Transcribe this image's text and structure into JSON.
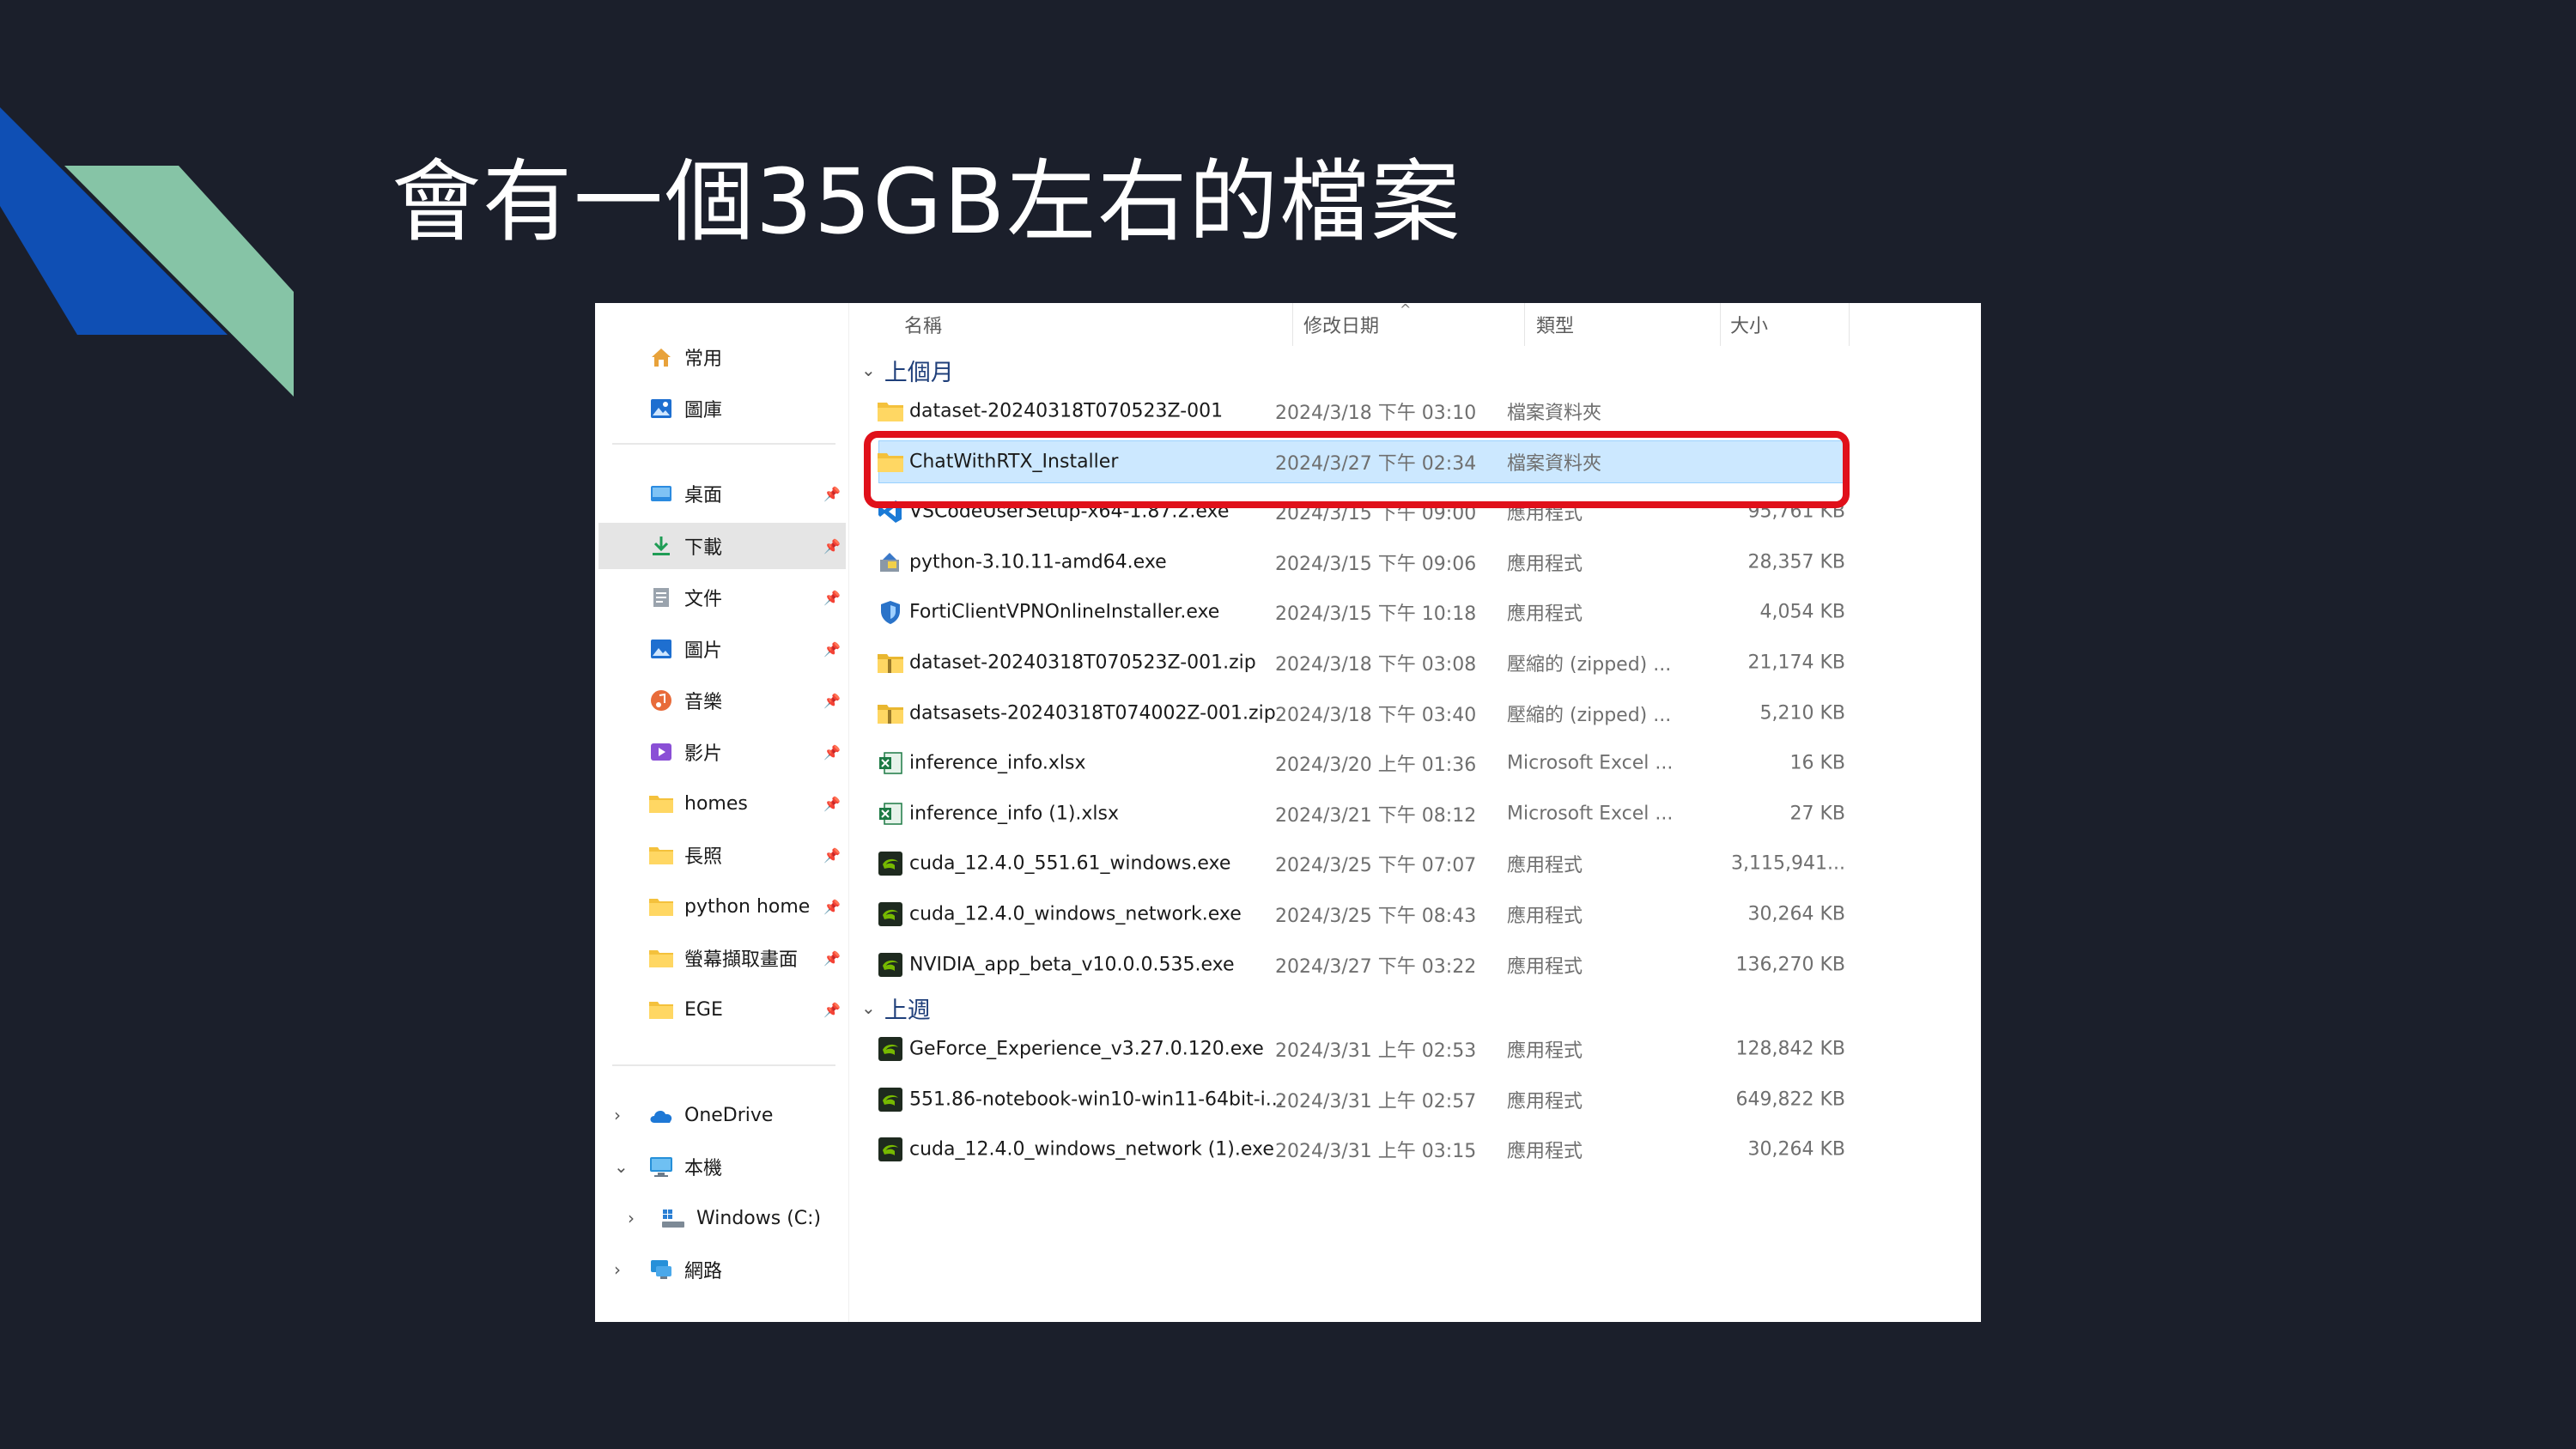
{
  "slide": {
    "title": "會有一個35GB左右的檔案",
    "accent_colors": {
      "blue": "#0f4fb4",
      "green": "#86c4a6",
      "background": "#1b1f2b",
      "highlight": "#e0101a"
    }
  },
  "explorer": {
    "nav": {
      "quick": [
        {
          "label": "常用",
          "icon": "home-icon"
        },
        {
          "label": "圖庫",
          "icon": "gallery-icon"
        }
      ],
      "pinned": [
        {
          "label": "桌面",
          "icon": "desktop-icon"
        },
        {
          "label": "下載",
          "icon": "download-icon",
          "selected": true
        },
        {
          "label": "文件",
          "icon": "document-icon"
        },
        {
          "label": "圖片",
          "icon": "pictures-icon"
        },
        {
          "label": "音樂",
          "icon": "music-icon"
        },
        {
          "label": "影片",
          "icon": "videos-icon"
        },
        {
          "label": "homes",
          "icon": "folder-icon"
        },
        {
          "label": "長照",
          "icon": "folder-icon"
        },
        {
          "label": "python home",
          "icon": "folder-icon"
        },
        {
          "label": "螢幕擷取畫面",
          "icon": "folder-icon"
        },
        {
          "label": "EGE",
          "icon": "folder-icon"
        }
      ],
      "tree": [
        {
          "label": "OneDrive",
          "icon": "cloud-icon",
          "chevron": "›"
        },
        {
          "label": "本機",
          "icon": "pc-icon",
          "chevron": "⌄"
        },
        {
          "label": "Windows (C:)",
          "icon": "drive-icon",
          "chevron": "›"
        },
        {
          "label": "網路",
          "icon": "network-icon",
          "chevron": "›"
        }
      ],
      "pin_glyph": "📌"
    },
    "columns": {
      "name": "名稱",
      "date": "修改日期",
      "type": "類型",
      "size": "大小"
    },
    "groups": [
      {
        "label": "上個月",
        "rows": [
          {
            "name": "dataset-20240318T070523Z-001",
            "date": "2024/3/18 下午 03:10",
            "type": "檔案資料夾",
            "size": "",
            "icon": "folder"
          },
          {
            "name": "ChatWithRTX_Installer",
            "date": "2024/3/27 下午 02:34",
            "type": "檔案資料夾",
            "size": "",
            "icon": "folder",
            "selected": true
          },
          {
            "name": "VSCodeUserSetup-x64-1.87.2.exe",
            "date": "2024/3/15 下午 09:00",
            "type": "應用程式",
            "size": "95,761 KB",
            "icon": "vscode"
          },
          {
            "name": "python-3.10.11-amd64.exe",
            "date": "2024/3/15 下午 09:06",
            "type": "應用程式",
            "size": "28,357 KB",
            "icon": "installer"
          },
          {
            "name": "FortiClientVPNOnlineInstaller.exe",
            "date": "2024/3/15 下午 10:18",
            "type": "應用程式",
            "size": "4,054 KB",
            "icon": "shield"
          },
          {
            "name": "dataset-20240318T070523Z-001.zip",
            "date": "2024/3/18 下午 03:08",
            "type": "壓縮的 (zipped) ...",
            "size": "21,174 KB",
            "icon": "zip"
          },
          {
            "name": "datsasets-20240318T074002Z-001.zip",
            "date": "2024/3/18 下午 03:40",
            "type": "壓縮的 (zipped) ...",
            "size": "5,210 KB",
            "icon": "zip"
          },
          {
            "name": "inference_info.xlsx",
            "date": "2024/3/20 上午 01:36",
            "type": "Microsoft Excel ...",
            "size": "16 KB",
            "icon": "excel"
          },
          {
            "name": "inference_info (1).xlsx",
            "date": "2024/3/21 下午 08:12",
            "type": "Microsoft Excel ...",
            "size": "27 KB",
            "icon": "excel"
          },
          {
            "name": "cuda_12.4.0_551.61_windows.exe",
            "date": "2024/3/25 下午 07:07",
            "type": "應用程式",
            "size": "3,115,941...",
            "icon": "nvidia"
          },
          {
            "name": "cuda_12.4.0_windows_network.exe",
            "date": "2024/3/25 下午 08:43",
            "type": "應用程式",
            "size": "30,264 KB",
            "icon": "nvidia"
          },
          {
            "name": "NVIDIA_app_beta_v10.0.0.535.exe",
            "date": "2024/3/27 下午 03:22",
            "type": "應用程式",
            "size": "136,270 KB",
            "icon": "nvidia"
          }
        ]
      },
      {
        "label": "上週",
        "rows": [
          {
            "name": "GeForce_Experience_v3.27.0.120.exe",
            "date": "2024/3/31 上午 02:53",
            "type": "應用程式",
            "size": "128,842 KB",
            "icon": "nvidia"
          },
          {
            "name": "551.86-notebook-win10-win11-64bit-i...",
            "date": "2024/3/31 上午 02:57",
            "type": "應用程式",
            "size": "649,822 KB",
            "icon": "nvidia"
          },
          {
            "name": "cuda_12.4.0_windows_network (1).exe",
            "date": "2024/3/31 上午 03:15",
            "type": "應用程式",
            "size": "30,264 KB",
            "icon": "nvidia"
          }
        ]
      }
    ]
  }
}
